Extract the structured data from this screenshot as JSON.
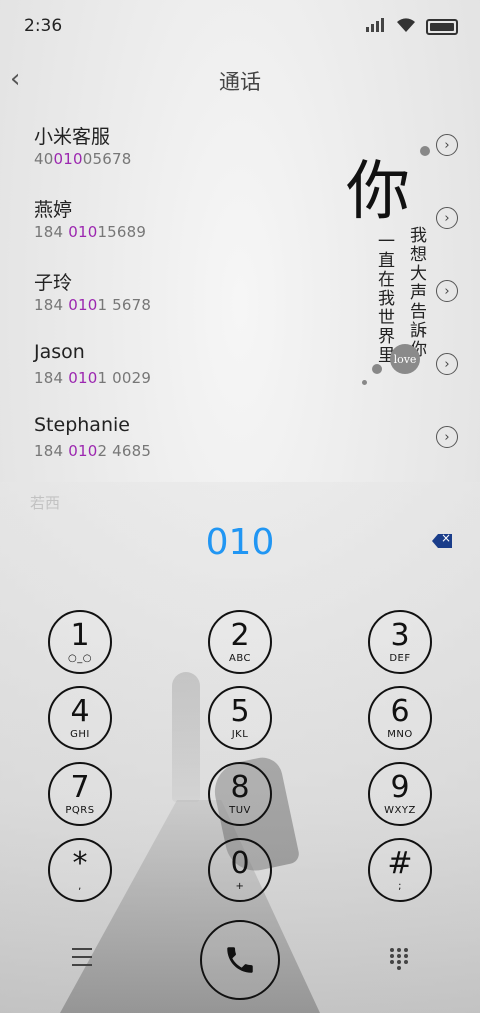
{
  "status": {
    "time": "2:36"
  },
  "header": {
    "back_icon": "chevron-left-icon",
    "title": "通话"
  },
  "contacts": [
    {
      "name": "小米客服",
      "num_pre": "40",
      "num_hl": "010",
      "num_post": "05678"
    },
    {
      "name": "燕婷",
      "num_pre": "184 ",
      "num_hl": "010",
      "num_post": "15689"
    },
    {
      "name": "子玲",
      "num_pre": "184 ",
      "num_hl": "010",
      "num_post": "1 5678"
    },
    {
      "name": "Jason",
      "num_pre": "184 ",
      "num_hl": "010",
      "num_post": "1 0029"
    },
    {
      "name": "Stephanie",
      "num_pre": "184 ",
      "num_hl": "010",
      "num_post": "2 4685"
    }
  ],
  "peek_item": "若西",
  "decor": {
    "big_char": "你",
    "line1": "我想大声告訴你",
    "line2": "一直在我世界里",
    "love": "love"
  },
  "dialer": {
    "input": "010",
    "keys": [
      {
        "digit": "1",
        "letters": "○_○"
      },
      {
        "digit": "2",
        "letters": "ABC"
      },
      {
        "digit": "3",
        "letters": "DEF"
      },
      {
        "digit": "4",
        "letters": "GHI"
      },
      {
        "digit": "5",
        "letters": "JKL"
      },
      {
        "digit": "6",
        "letters": "MNO"
      },
      {
        "digit": "7",
        "letters": "PQRS"
      },
      {
        "digit": "8",
        "letters": "TUV"
      },
      {
        "digit": "9",
        "letters": "WXYZ"
      },
      {
        "digit": "*",
        "letters": ","
      },
      {
        "digit": "0",
        "letters": "+"
      },
      {
        "digit": "#",
        "letters": ";"
      }
    ]
  },
  "colors": {
    "accent": "#2196f3",
    "highlight": "#9c27b0"
  }
}
